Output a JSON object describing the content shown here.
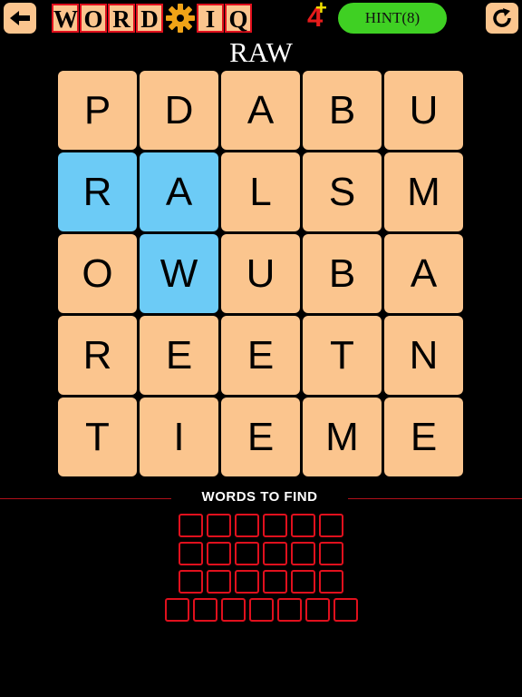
{
  "header": {
    "back_icon": "arrow-left-icon",
    "logo_letters_left": [
      "W",
      "O",
      "R",
      "D"
    ],
    "logo_gear_icon": "gear-icon",
    "logo_letters_right": [
      "I",
      "Q"
    ],
    "level": "4",
    "plus": "+",
    "hint_label": "HINT(8)",
    "refresh_icon": "refresh-icon"
  },
  "current_word": "RAW",
  "grid": [
    [
      "P",
      "D",
      "A",
      "B",
      "U"
    ],
    [
      "R",
      "A",
      "L",
      "S",
      "M"
    ],
    [
      "O",
      "W",
      "U",
      "B",
      "A"
    ],
    [
      "R",
      "E",
      "E",
      "T",
      "N"
    ],
    [
      "T",
      "I",
      "E",
      "M",
      "E"
    ]
  ],
  "selected_cells": [
    [
      1,
      0
    ],
    [
      1,
      1
    ],
    [
      2,
      1
    ]
  ],
  "words_section": {
    "label": "WORDS TO FIND",
    "word_lengths": [
      6,
      6,
      6,
      7
    ]
  },
  "colors": {
    "tile": "#fbc58e",
    "selected_tile": "#6ccbf6",
    "hint_button": "#3fd023",
    "accent_red": "#e0101d",
    "background": "#000000"
  }
}
